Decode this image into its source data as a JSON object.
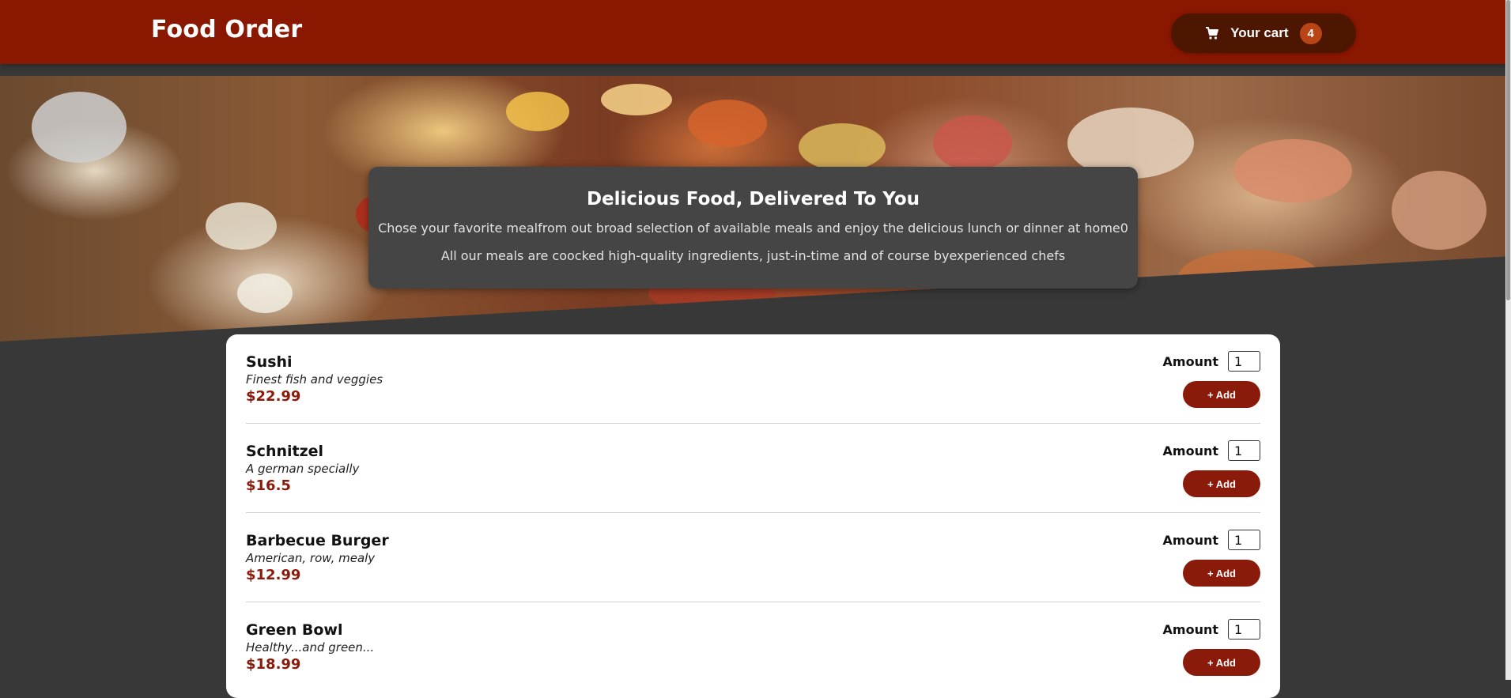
{
  "header": {
    "title": "Food Order",
    "cart": {
      "icon": "cart-icon",
      "label": "Your cart",
      "count": "4"
    }
  },
  "summary": {
    "title": "Delicious Food, Delivered To You",
    "paragraphs": [
      "Chose your favorite mealfrom out broad selection of available meals and enjoy the delicious lunch or dinner at home0",
      "All our meals are coocked high-quality ingredients, just-in-time and of course byexperienced chefs"
    ]
  },
  "meals": [
    {
      "name": "Sushi",
      "description": "Finest fish and veggies",
      "price": "$22.99",
      "amount_label": "Amount",
      "amount": "1",
      "add_label": "+ Add"
    },
    {
      "name": "Schnitzel",
      "description": "A german specially",
      "price": "$16.5",
      "amount_label": "Amount",
      "amount": "1",
      "add_label": "+ Add"
    },
    {
      "name": "Barbecue Burger",
      "description": "American, row, mealy",
      "price": "$12.99",
      "amount_label": "Amount",
      "amount": "1",
      "add_label": "+ Add"
    },
    {
      "name": "Green Bowl",
      "description": "Healthy...and green...",
      "price": "$18.99",
      "amount_label": "Amount",
      "amount": "1",
      "add_label": "+ Add"
    }
  ],
  "colors": {
    "header_bg": "#8a1700",
    "cart_button_bg": "#4d1601",
    "cart_badge_bg": "#b94517",
    "page_bg": "#383838",
    "summary_bg": "#454545",
    "price": "#8a1a0a",
    "add_button_bg": "#8a1a0a"
  }
}
